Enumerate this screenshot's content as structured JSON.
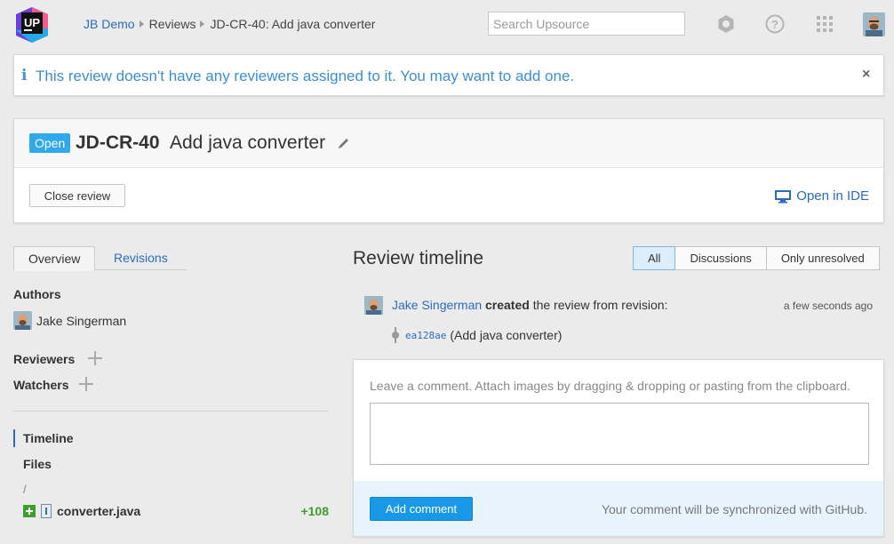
{
  "header": {
    "logo_text": "UP",
    "breadcrumb": [
      "JB Demo",
      "Reviews",
      "JD-CR-40: Add java converter"
    ],
    "search_placeholder": "Search Upsource"
  },
  "alert": {
    "message": "This review doesn't have any reviewers assigned to it. You may want to add one.",
    "close_glyph": "×",
    "info_glyph": "i"
  },
  "review": {
    "status": "Open",
    "id": "JD-CR-40",
    "title": "Add java converter",
    "close_button": "Close review",
    "open_ide": "Open in IDE"
  },
  "sidebar": {
    "tabs": [
      "Overview",
      "Revisions"
    ],
    "authors_label": "Authors",
    "author_name": "Jake Singerman",
    "reviewers_label": "Reviewers",
    "watchers_label": "Watchers",
    "nav": [
      "Timeline",
      "Files"
    ],
    "path_root": "/",
    "file": {
      "name": "converter.java",
      "added": "+108"
    }
  },
  "timeline": {
    "title": "Review timeline",
    "filters": [
      "All",
      "Discussions",
      "Only unresolved"
    ],
    "event": {
      "author": "Jake Singerman",
      "action_bold": "created",
      "action_rest": " the review from revision:",
      "time": "a few seconds ago"
    },
    "revision": {
      "hash": "ea128ae",
      "message": "(Add java converter)"
    }
  },
  "comment": {
    "hint": "Leave a comment. Attach images by dragging & dropping or pasting from the clipboard.",
    "add_button": "Add comment",
    "sync_note": "Your comment will be synchronized with GitHub."
  },
  "colors": {
    "accent": "#2a6cc1",
    "open_badge": "#2fa9ec",
    "add_button": "#1a98e8",
    "added_lines": "#3d9e2e",
    "alert_text": "#3a8ed4"
  }
}
